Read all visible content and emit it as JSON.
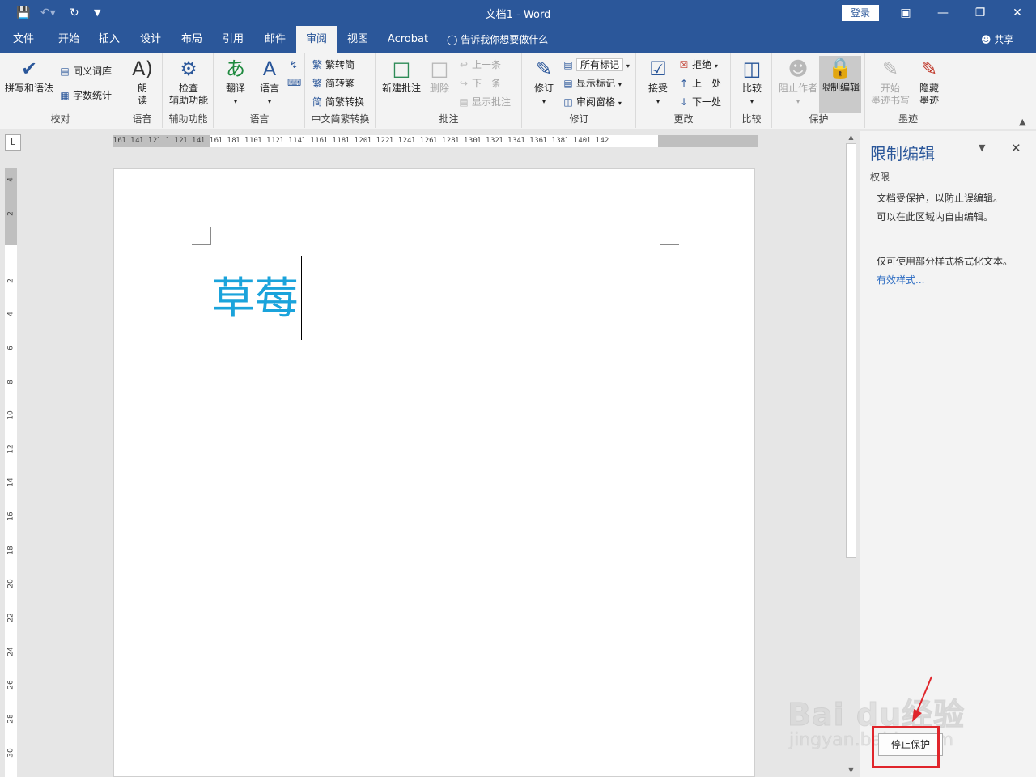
{
  "titlebar": {
    "title": "文档1  -  Word",
    "login": "登录",
    "bg": "#2b579a"
  },
  "tabs": [
    {
      "label": "文件"
    },
    {
      "label": "开始"
    },
    {
      "label": "插入"
    },
    {
      "label": "设计"
    },
    {
      "label": "布局"
    },
    {
      "label": "引用"
    },
    {
      "label": "邮件"
    },
    {
      "label": "审阅"
    },
    {
      "label": "视图"
    },
    {
      "label": "Acrobat"
    }
  ],
  "active_tab": "审阅",
  "tellme": "告诉我你想要做什么",
  "share": "共享",
  "ribbon": {
    "proofing": {
      "spelling": "拼写和语法",
      "thesaurus": "同义词库",
      "wordcount": "字数统计",
      "label": "校对"
    },
    "speech": {
      "read": "朗\n读",
      "label": "语音"
    },
    "accessibility": {
      "check": "检查\n辅助功能",
      "label": "辅助功能"
    },
    "language": {
      "translate": "翻译",
      "language": "语言",
      "label": "语言"
    },
    "chinese": {
      "t2s": "繁转简",
      "s2t": "简转繁",
      "convert": "简繁转换",
      "label": "中文简繁转换"
    },
    "comments": {
      "new": "新建批注",
      "delete": "删除",
      "prev": "上一条",
      "next": "下一条",
      "show": "显示批注",
      "label": "批注"
    },
    "tracking": {
      "track": "修订",
      "markup": "所有标记",
      "show_markup": "显示标记",
      "pane": "审阅窗格",
      "label": "修订"
    },
    "changes": {
      "accept": "接受",
      "reject": "拒绝",
      "prev": "上一处",
      "next": "下一处",
      "label": "更改"
    },
    "compare": {
      "compare": "比较",
      "label": "比较"
    },
    "protect": {
      "block": "阻止作者",
      "restrict": "限制编辑",
      "label": "保护"
    },
    "ink": {
      "start": "开始\n墨迹书写",
      "hide": "隐藏\n墨迹",
      "label": "墨迹"
    }
  },
  "ruler": {
    "hnums": "l6l l4l l2l  l  l2l l4l l6l l8l l10l l12l l14l l16l l18l l20l l22l l24l l26l l28l l30l l32l l34l l36l l38l l40l l42",
    "vnums": [
      "4",
      "2",
      "2",
      "4",
      "6",
      "8",
      "10",
      "12",
      "14",
      "16",
      "18",
      "20",
      "22",
      "24",
      "26",
      "28",
      "30"
    ]
  },
  "document": {
    "text": "草莓",
    "text_color": "#1aa3db"
  },
  "pane": {
    "title": "限制编辑",
    "section": "权限",
    "line1": "文档受保护，以防止误编辑。",
    "line2": "可以在此区域内自由编辑。",
    "line3": "仅可使用部分样式格式化文本。",
    "link": "有效样式...",
    "stop_button": "停止保护"
  },
  "watermark": {
    "brand": "Bai du经验",
    "url": "jingyan.baidu.com"
  }
}
